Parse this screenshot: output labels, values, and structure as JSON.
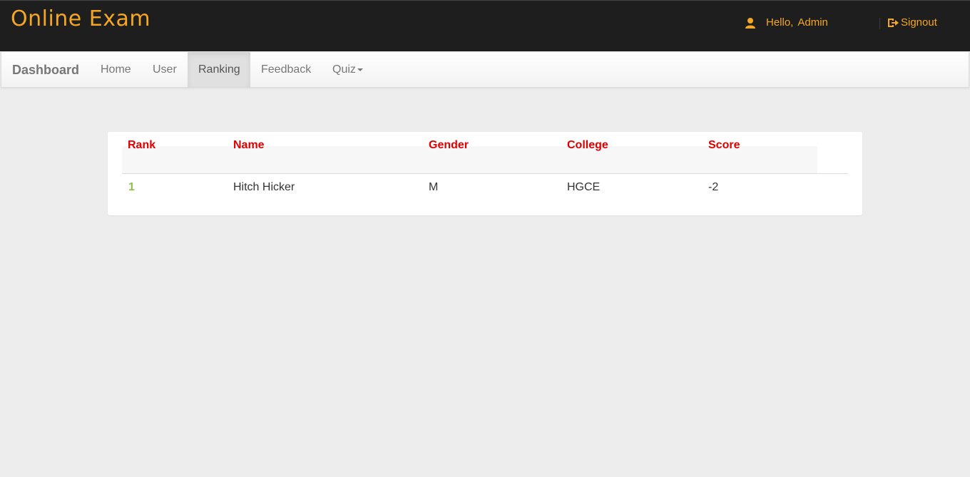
{
  "header": {
    "logo": "Online Exam",
    "greeting": "Hello,",
    "username": "Admin",
    "signout_label": "Signout",
    "accent_color": "#f5a623"
  },
  "navbar": {
    "brand": "Dashboard",
    "items": [
      {
        "label": "Home",
        "active": false
      },
      {
        "label": "User",
        "active": false
      },
      {
        "label": "Ranking",
        "active": true
      },
      {
        "label": "Feedback",
        "active": false
      },
      {
        "label": "Quiz",
        "active": false,
        "dropdown": true
      }
    ]
  },
  "ranking_table": {
    "headers": [
      "Rank",
      "Name",
      "Gender",
      "College",
      "Score"
    ],
    "rows": [
      [
        "1",
        "Hitch Hicker",
        "M",
        "HGCE",
        "-2"
      ]
    ]
  },
  "colors": {
    "header_bg": "#1e1e1e",
    "table_header_text": "#e00000",
    "rank_text": "#8bc34a"
  }
}
